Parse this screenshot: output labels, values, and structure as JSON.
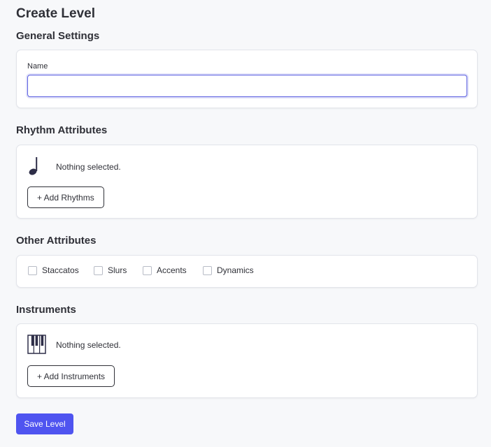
{
  "page": {
    "title": "Create Level"
  },
  "general": {
    "title": "General Settings",
    "name_label": "Name",
    "name_value": "",
    "name_placeholder": ""
  },
  "rhythm": {
    "title": "Rhythm Attributes",
    "icon": "quarter-note-icon",
    "status": "Nothing selected.",
    "add_label": "+ Add Rhythms"
  },
  "other": {
    "title": "Other Attributes",
    "options": [
      {
        "label": "Staccatos",
        "checked": false
      },
      {
        "label": "Slurs",
        "checked": false
      },
      {
        "label": "Accents",
        "checked": false
      },
      {
        "label": "Dynamics",
        "checked": false
      }
    ]
  },
  "instruments": {
    "title": "Instruments",
    "icon": "piano-keys-icon",
    "status": "Nothing selected.",
    "add_label": "+ Add Instruments"
  },
  "actions": {
    "save_label": "Save Level"
  },
  "colors": {
    "accent": "#4f54f0",
    "icon": "#2e2e48",
    "text": "#2f3037",
    "background": "#f7f8fa"
  }
}
